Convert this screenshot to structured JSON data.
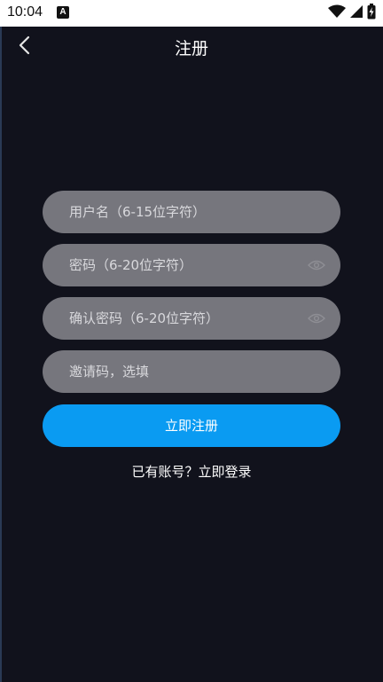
{
  "status_bar": {
    "time": "10:04",
    "notification_icon": "a-icon",
    "icons": [
      "wifi-icon",
      "signal-icon",
      "battery-icon"
    ]
  },
  "header": {
    "back_icon": "chevron-left-icon",
    "title": "注册"
  },
  "form": {
    "username": {
      "placeholder": "用户名（6-15位字符）",
      "value": ""
    },
    "password": {
      "placeholder": "密码（6-20位字符）",
      "value": "",
      "toggle_icon": "eye-icon"
    },
    "confirm_password": {
      "placeholder": "确认密码（6-20位字符）",
      "value": "",
      "toggle_icon": "eye-icon"
    },
    "invite_code": {
      "placeholder": "邀请码，选填",
      "value": ""
    },
    "submit_label": "立即注册"
  },
  "footer": {
    "login_link": "已有账号？立即登录"
  },
  "colors": {
    "background": "#11121c",
    "field": "#76767d",
    "accent": "#0a9bf2",
    "text": "#ffffff"
  }
}
